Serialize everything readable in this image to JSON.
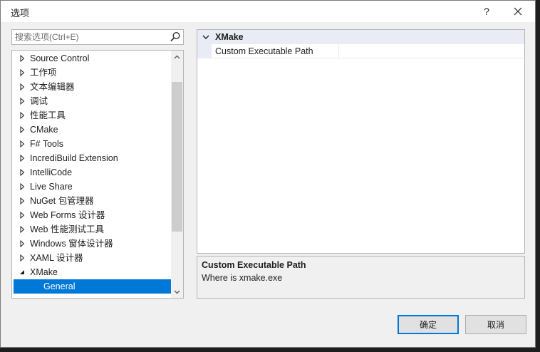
{
  "window": {
    "title": "选项",
    "help_label": "?",
    "close_label": "✕"
  },
  "search": {
    "placeholder": "搜索选项(Ctrl+E)"
  },
  "tree": {
    "items": [
      {
        "label": "Source Control",
        "expanded": false
      },
      {
        "label": "工作项",
        "expanded": false
      },
      {
        "label": "文本编辑器",
        "expanded": false
      },
      {
        "label": "调试",
        "expanded": false
      },
      {
        "label": "性能工具",
        "expanded": false
      },
      {
        "label": "CMake",
        "expanded": false
      },
      {
        "label": "F# Tools",
        "expanded": false
      },
      {
        "label": "IncrediBuild Extension",
        "expanded": false
      },
      {
        "label": "IntelliCode",
        "expanded": false
      },
      {
        "label": "Live Share",
        "expanded": false
      },
      {
        "label": "NuGet 包管理器",
        "expanded": false
      },
      {
        "label": "Web Forms 设计器",
        "expanded": false
      },
      {
        "label": "Web 性能测试工具",
        "expanded": false
      },
      {
        "label": "Windows 窗体设计器",
        "expanded": false
      },
      {
        "label": "XAML 设计器",
        "expanded": false
      },
      {
        "label": "XMake",
        "expanded": true
      },
      {
        "label": "General",
        "selected": true
      }
    ]
  },
  "property_grid": {
    "category": "XMake",
    "rows": [
      {
        "name": "Custom Executable Path",
        "value": ""
      }
    ]
  },
  "description": {
    "title": "Custom Executable Path",
    "text": "Where is xmake.exe"
  },
  "buttons": {
    "ok_label": "确定",
    "cancel_label": "取消"
  },
  "colors": {
    "accent": "#0078d7",
    "category_bg": "#e9ecf5"
  }
}
